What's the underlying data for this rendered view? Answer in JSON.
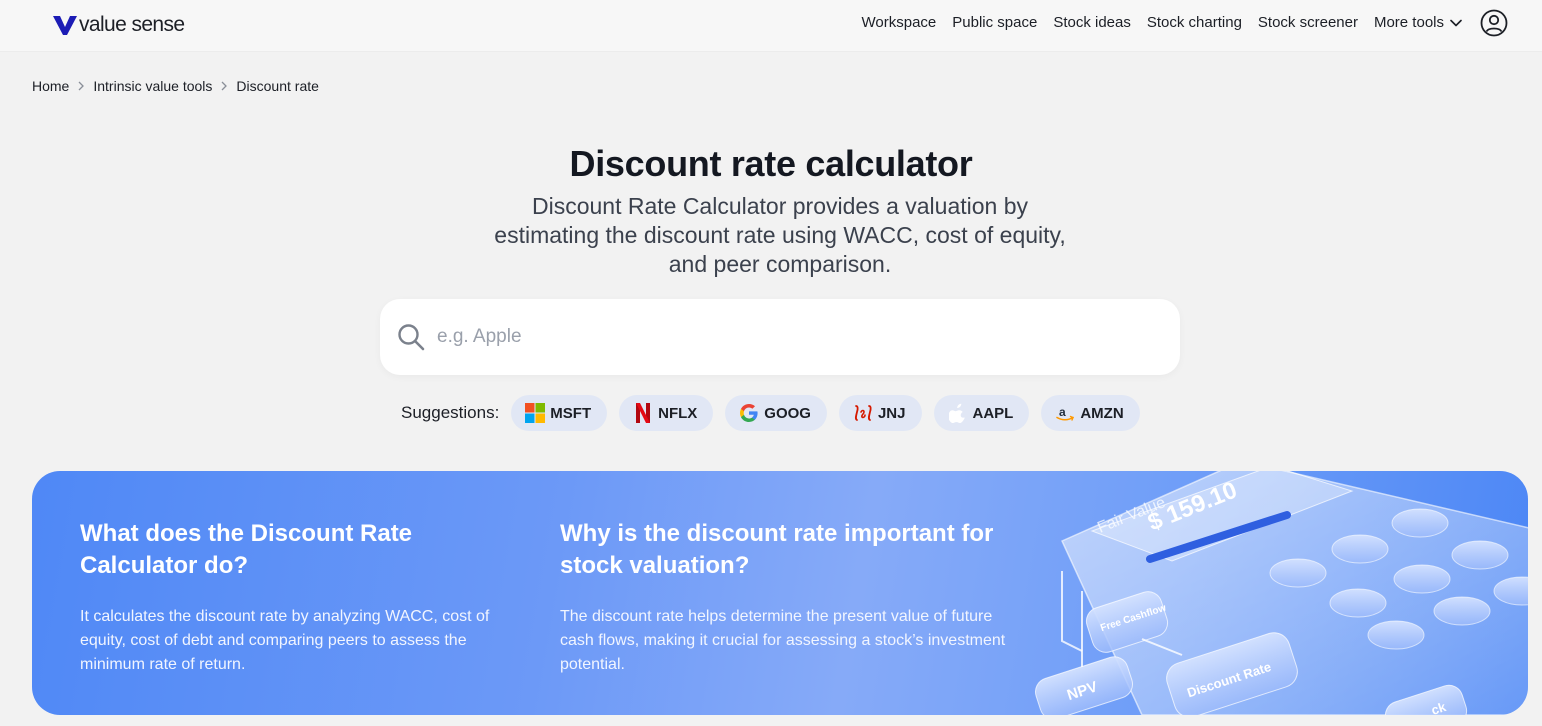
{
  "header": {
    "logo_text": "value sense",
    "nav": [
      "Workspace",
      "Public space",
      "Stock ideas",
      "Stock charting",
      "Stock screener"
    ],
    "more_tools": "More tools"
  },
  "breadcrumb": [
    "Home",
    "Intrinsic value tools",
    "Discount rate"
  ],
  "hero": {
    "title": "Discount rate calculator",
    "subtitle": "Discount Rate Calculator provides a valuation by estimating the discount rate using WACC, cost of equity, and peer comparison."
  },
  "search": {
    "placeholder": "e.g. Apple",
    "value": ""
  },
  "suggestions": {
    "label": "Suggestions:",
    "items": [
      {
        "ticker": "MSFT",
        "icon": "microsoft-logo-icon"
      },
      {
        "ticker": "NFLX",
        "icon": "netflix-logo-icon"
      },
      {
        "ticker": "GOOG",
        "icon": "google-logo-icon"
      },
      {
        "ticker": "JNJ",
        "icon": "jnj-logo-icon"
      },
      {
        "ticker": "AAPL",
        "icon": "apple-logo-icon"
      },
      {
        "ticker": "AMZN",
        "icon": "amazon-logo-icon"
      }
    ]
  },
  "info": {
    "col1": {
      "heading": "What does the Discount Rate Calculator do?",
      "body": "It calculates the discount rate by analyzing WACC, cost of equity, cost of debt and comparing peers to assess the minimum rate of return."
    },
    "col2": {
      "heading": "Why is the discount rate important for stock valuation?",
      "body": "The discount rate helps determine the present value of future cash flows, making it crucial for assessing a stock’s investment potential."
    }
  },
  "illustration": {
    "fair_value_label": "Fair Value",
    "fair_value_amount": "$ 159.10",
    "tiles": [
      "Free Cashflow",
      "NPV",
      "Discount Rate",
      "ck"
    ]
  },
  "colors": {
    "banner": "#6c99f7",
    "chip_bg": "#e1e7f5",
    "brand": "#1f1fb8"
  }
}
